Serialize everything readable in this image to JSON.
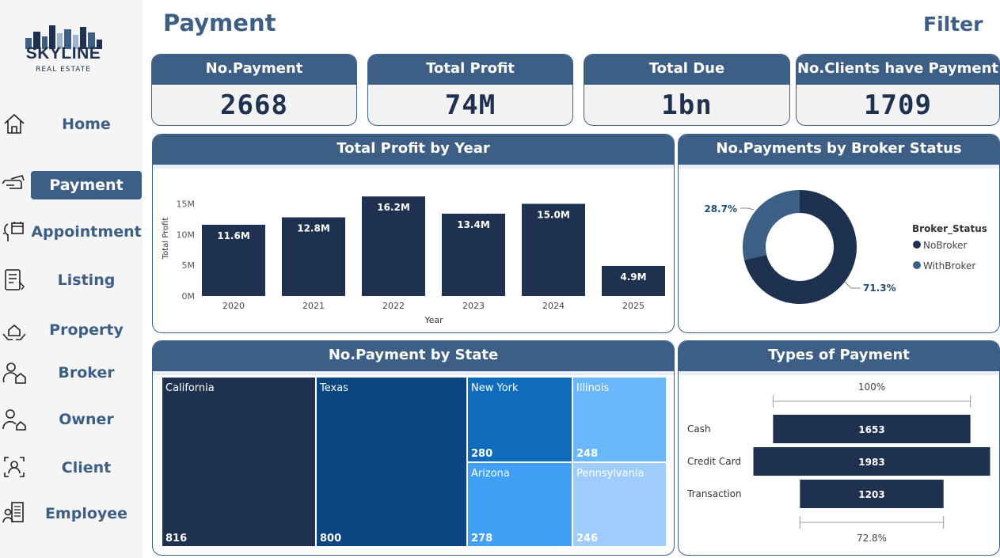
{
  "brand": {
    "name": "SKYLINE",
    "tagline": "REAL ESTATE"
  },
  "sidebar": {
    "items": [
      {
        "label": "Home",
        "icon": "home-icon"
      },
      {
        "label": "Payment",
        "icon": "payment-icon",
        "active": true
      },
      {
        "label": "Appointment",
        "icon": "calendar-head-icon"
      },
      {
        "label": "Listing",
        "icon": "listing-icon"
      },
      {
        "label": "Property",
        "icon": "property-icon"
      },
      {
        "label": "Broker",
        "icon": "broker-icon"
      },
      {
        "label": "Owner",
        "icon": "owner-icon"
      },
      {
        "label": "Client",
        "icon": "client-icon"
      },
      {
        "label": "Employee",
        "icon": "employee-icon"
      }
    ]
  },
  "header": {
    "title": "Payment",
    "filter_label": "Filter"
  },
  "kpis": [
    {
      "label": "No.Payment",
      "value": "2668"
    },
    {
      "label": "Total Profit",
      "value": "74M"
    },
    {
      "label": "Total Due",
      "value": "1bn"
    },
    {
      "label": "No.Clients have Payment",
      "value": "1709"
    }
  ],
  "panels": {
    "profit_by_year": "Total Profit by Year",
    "broker_status": "No.Payments by Broker Status",
    "by_state": "No.Payment by State",
    "types": "Types of Payment"
  },
  "colors": {
    "primary": "#3e5f85",
    "dark": "#1f3150",
    "navy": "#0b4680",
    "blue": "#0f6cbd",
    "sky": "#3fa0f5",
    "light": "#6bb7fb",
    "pale": "#9ecdfb"
  },
  "chart_data": [
    {
      "type": "bar",
      "categories": [
        "2020",
        "2021",
        "2022",
        "2023",
        "2024",
        "2025"
      ],
      "values": [
        11.6,
        12.8,
        16.2,
        13.4,
        15.0,
        4.9
      ],
      "data_labels": [
        "11.6M",
        "12.8M",
        "16.2M",
        "13.4M",
        "15.0M",
        "4.9M"
      ],
      "title": "Total Profit by Year",
      "xlabel": "Year",
      "ylabel": "Total Profit",
      "ylim": [
        0,
        17
      ],
      "yticks": [
        0,
        5,
        10,
        15
      ],
      "ytick_labels": [
        "0M",
        "5M",
        "10M",
        "15M"
      ],
      "grid": false
    },
    {
      "type": "pie",
      "donut": true,
      "title": "No.Payments by Broker Status",
      "legend_title": "Broker_Status",
      "legend_position": "right",
      "labels": [
        "NoBroker",
        "WithBroker"
      ],
      "values": [
        71.3,
        28.7
      ],
      "data_labels": [
        "71.3%",
        "28.7%"
      ],
      "colors": [
        "#1f3150",
        "#3e5f85"
      ]
    },
    {
      "type": "treemap",
      "title": "No.Payment by State",
      "labels": [
        "California",
        "Texas",
        "New York",
        "Illinois",
        "Arizona",
        "Pennsylvania"
      ],
      "values": [
        816,
        800,
        280,
        248,
        278,
        246
      ],
      "colors": [
        "#1f3150",
        "#0b4680",
        "#0f6cbd",
        "#6bb7fb",
        "#3fa0f5",
        "#9ecdfb"
      ]
    },
    {
      "type": "funnel",
      "title": "Types of Payment",
      "categories": [
        "Cash",
        "Credit Card",
        "Transaction"
      ],
      "values": [
        1653,
        1983,
        1203
      ],
      "top_label": "100%",
      "bottom_label": "72.8%"
    }
  ]
}
